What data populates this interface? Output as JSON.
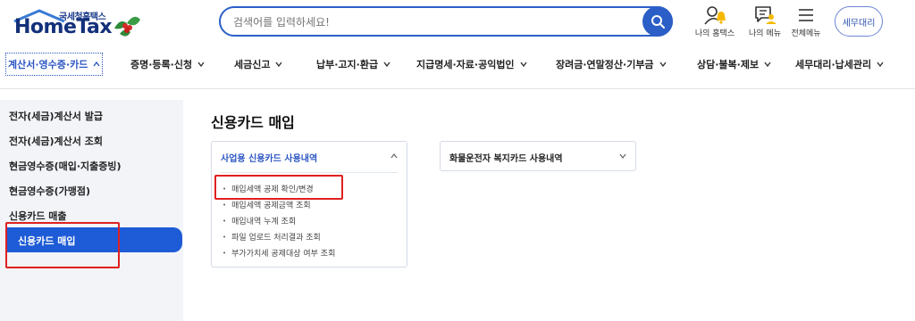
{
  "brand": {
    "sub": "국세청홈택스",
    "name": "HomeTax"
  },
  "search": {
    "placeholder": "검색어를 입력하세요!"
  },
  "util": {
    "my_hometax": "나의 홈택스",
    "my_menu": "나의 메뉴",
    "all_menu": "전체메뉴",
    "tax_agent": "세무대리"
  },
  "gnb": [
    {
      "label": "계산서·영수증·카드"
    },
    {
      "label": "증명·등록·신청"
    },
    {
      "label": "세금신고"
    },
    {
      "label": "납부·고지·환급"
    },
    {
      "label": "지급명세·자료·공익법인"
    },
    {
      "label": "장려금·연말정산·기부금"
    },
    {
      "label": "상담·불복·제보"
    },
    {
      "label": "세무대리·납세관리"
    }
  ],
  "sidebar": [
    {
      "label": "전자(세금)계산서 발급"
    },
    {
      "label": "전자(세금)계산서 조회"
    },
    {
      "label": "현금영수증(매입·지출증빙)"
    },
    {
      "label": "현금영수증(가맹점)"
    },
    {
      "label": "신용카드 매출"
    },
    {
      "label": "신용카드 매입"
    }
  ],
  "main": {
    "title": "신용카드 매입",
    "card1": {
      "title": "사업용 신용카드 사용내역",
      "links": [
        "매입세액 공제 확인/변경",
        "매입세액 공제금액 조회",
        "매입내역 누계 조회",
        "파일 업로드 처리결과 조회",
        "부가가치세 공제대상 여부 조회"
      ]
    },
    "card2": {
      "title": "화물운전자 복지카드 사용내역"
    }
  }
}
